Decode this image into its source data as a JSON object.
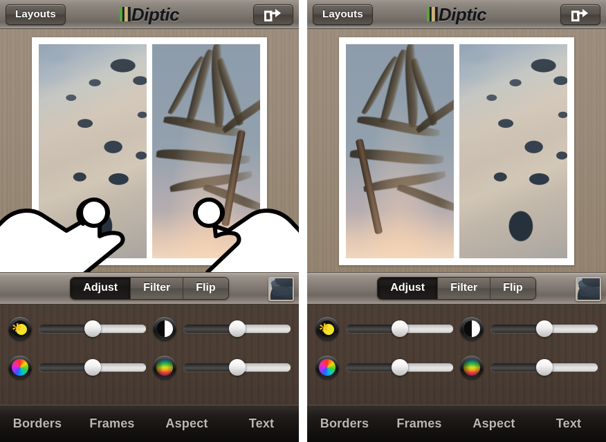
{
  "app": {
    "name": "Diptic",
    "logo_icon": "diptic-stripes-icon"
  },
  "header": {
    "layouts_label": "Layouts",
    "title": "Diptic",
    "share_icon": "share-export-icon"
  },
  "panels": [
    {
      "id": "before",
      "state_description": "two-finger swap gesture in progress",
      "cells": [
        {
          "position": "left",
          "photo": "beach-rocks-photo"
        },
        {
          "position": "right",
          "photo": "palm-tree-photo"
        }
      ],
      "gesture_overlay": {
        "visible": true,
        "hands": [
          {
            "name": "left-hand-pointer",
            "touch_point": "left-cell"
          },
          {
            "name": "right-hand-pointer",
            "touch_point": "right-cell"
          }
        ]
      }
    },
    {
      "id": "after",
      "state_description": "photos swapped after gesture",
      "cells": [
        {
          "position": "left",
          "photo": "palm-tree-photo"
        },
        {
          "position": "right",
          "photo": "beach-rocks-photo"
        }
      ],
      "gesture_overlay": {
        "visible": false,
        "hands": []
      }
    }
  ],
  "edit_toolbar": {
    "segments": [
      {
        "label": "Adjust",
        "active": true
      },
      {
        "label": "Filter",
        "active": false
      },
      {
        "label": "Flip",
        "active": false
      }
    ],
    "preview_thumbnail": "beach-rocks-thumbnail"
  },
  "adjust_sliders": [
    {
      "name": "brightness",
      "icon": "sun-icon",
      "value_percent": 50
    },
    {
      "name": "contrast",
      "icon": "contrast-icon",
      "value_percent": 50
    },
    {
      "name": "saturation",
      "icon": "color-wheel-icon",
      "value_percent": 50
    },
    {
      "name": "temperature",
      "icon": "color-spectrum-icon",
      "value_percent": 50
    }
  ],
  "bottom_nav": {
    "items": [
      {
        "label": "Borders"
      },
      {
        "label": "Frames"
      },
      {
        "label": "Aspect"
      },
      {
        "label": "Text"
      }
    ]
  },
  "colors": {
    "wood_light": "#9a8a79",
    "wood_dark": "#4a3c32",
    "toolbar_gray": "#837b74",
    "nav_dark": "#14110f",
    "nav_text": "#b9b9b9",
    "active_segment": "#181615",
    "frame_white": "#ffffff"
  }
}
